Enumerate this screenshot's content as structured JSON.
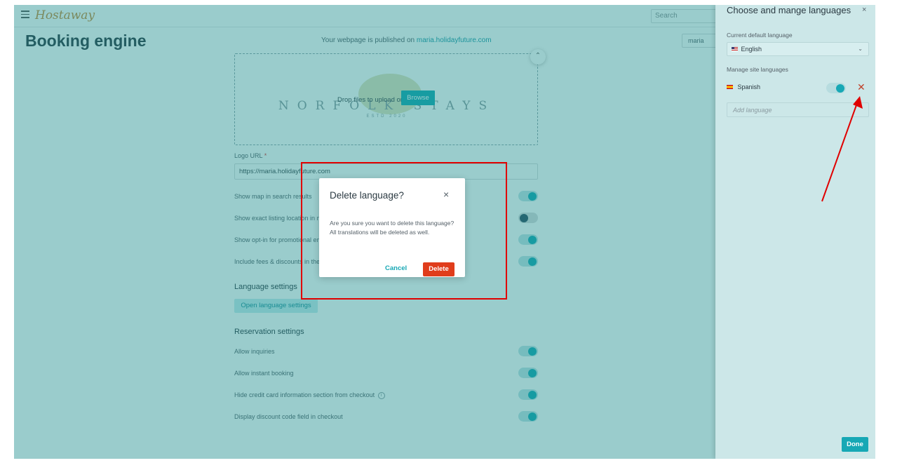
{
  "app": {
    "logo": "Hostaway",
    "search_placeholder": "Search",
    "page_title": "Booking engine",
    "published_prefix": "Your webpage is published on",
    "published_link": "maria.holidayfuture.com",
    "user_chip": "maria"
  },
  "upload": {
    "drop_text": "Drop files to upload or",
    "browse_label": "Browse",
    "brand_name": "NORFOLK STAYS",
    "brand_sub": "ESTD 2020"
  },
  "logo_url": {
    "label": "Logo URL",
    "required_mark": "*",
    "value": "https://maria.holidayfuture.com"
  },
  "settings": [
    {
      "label": "Show map in search results",
      "on": true
    },
    {
      "label": "Show exact listing location in map",
      "on": false
    },
    {
      "label": "Show opt-in for promotional emails",
      "on": true
    },
    {
      "label": "Include fees & discounts in the total",
      "on": true
    }
  ],
  "language_settings": {
    "title": "Language settings",
    "button": "Open language settings"
  },
  "reservation_settings": {
    "title": "Reservation settings",
    "rows": [
      {
        "label": "Allow inquiries",
        "on": true
      },
      {
        "label": "Allow instant booking",
        "on": true
      },
      {
        "label": "Hide credit card information section from checkout",
        "on": true,
        "info": "i"
      },
      {
        "label": "Display discount code field in checkout",
        "on": true
      }
    ]
  },
  "panel": {
    "title": "Choose and mange languages",
    "close": "×",
    "default_label": "Current default language",
    "default_value": "English",
    "manage_label": "Manage site languages",
    "languages": [
      {
        "name": "Spanish",
        "enabled": true
      }
    ],
    "remove_glyph": "✕",
    "add_placeholder": "Add language",
    "done_label": "Done"
  },
  "dialog": {
    "title": "Delete language?",
    "close": "×",
    "message": "Are you sure you want to delete this language? All translations will be deleted as well.",
    "cancel_label": "Cancel",
    "delete_label": "Delete"
  },
  "colors": {
    "accent": "#17a8b5",
    "danger": "#e03d1c",
    "annotation": "#e00000"
  }
}
